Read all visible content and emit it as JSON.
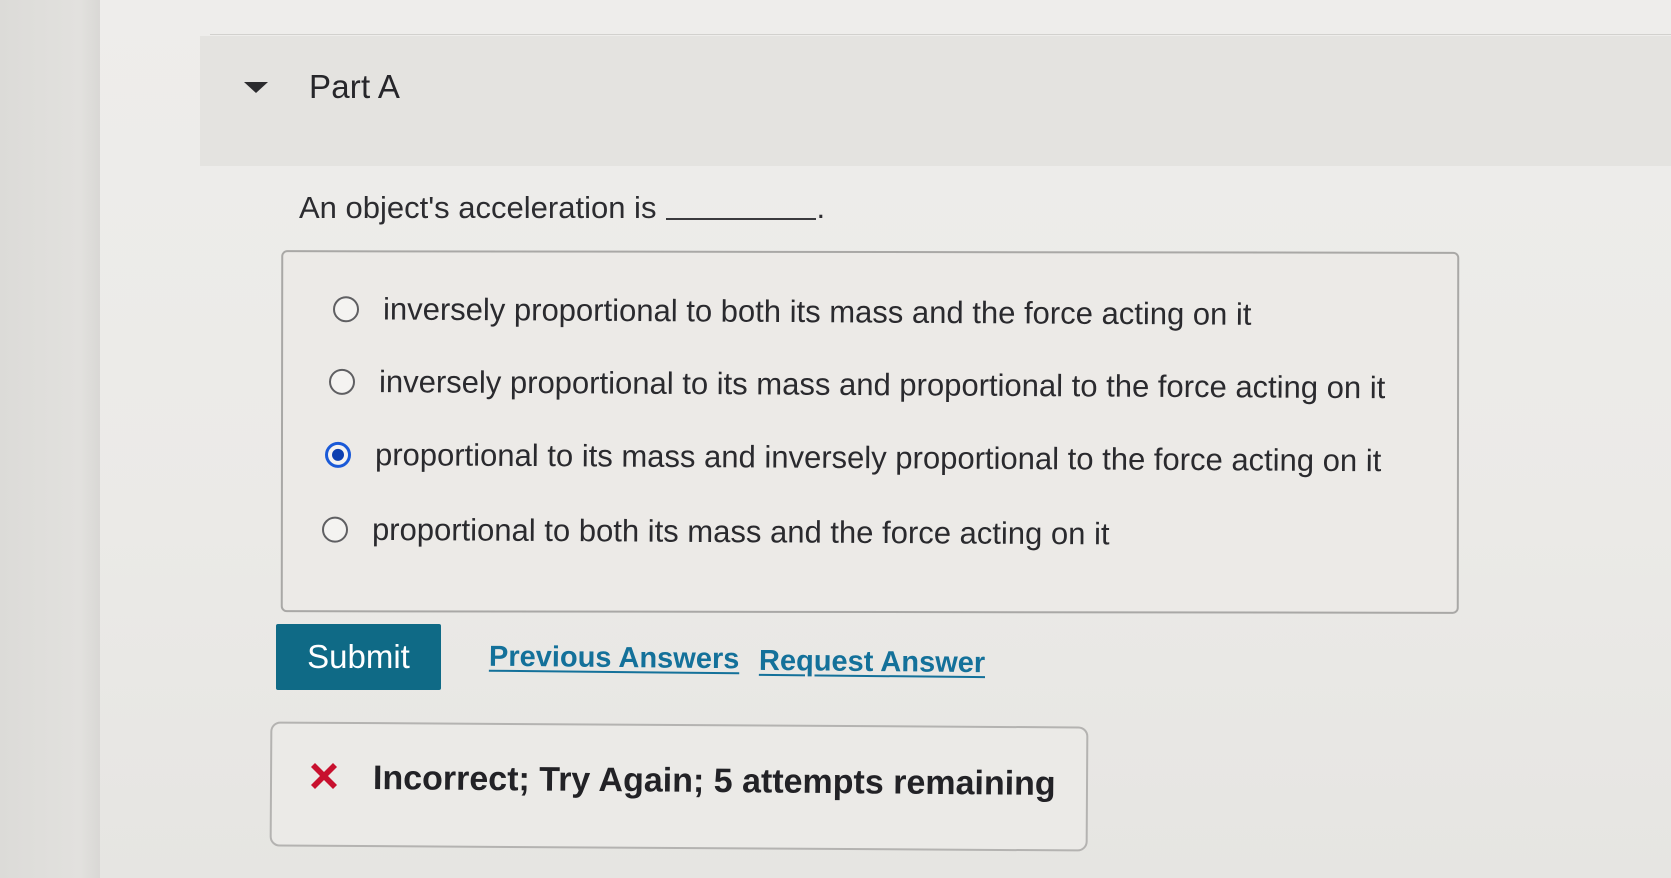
{
  "part": {
    "title": "Part A"
  },
  "question": {
    "text": "An object's acceleration is",
    "trailing": "."
  },
  "options": [
    {
      "label": "inversely proportional to both its mass and the force acting on it",
      "selected": false
    },
    {
      "label": "inversely proportional to its mass and proportional to the force acting on it",
      "selected": false
    },
    {
      "label": "proportional to its mass and inversely proportional to the force acting on it",
      "selected": true
    },
    {
      "label": "proportional to both its mass and the force acting on it",
      "selected": false
    }
  ],
  "actions": {
    "submit_label": "Submit",
    "previous_answers_label": "Previous Answers",
    "request_answer_label": "Request Answer"
  },
  "feedback": {
    "text": "Incorrect; Try Again; 5 attempts remaining",
    "icon": "x-mark-icon",
    "icon_color": "#c8102e"
  },
  "colors": {
    "submit_bg": "#0f6a86",
    "link": "#14719a",
    "radio_selected": "#1a5ad8"
  }
}
